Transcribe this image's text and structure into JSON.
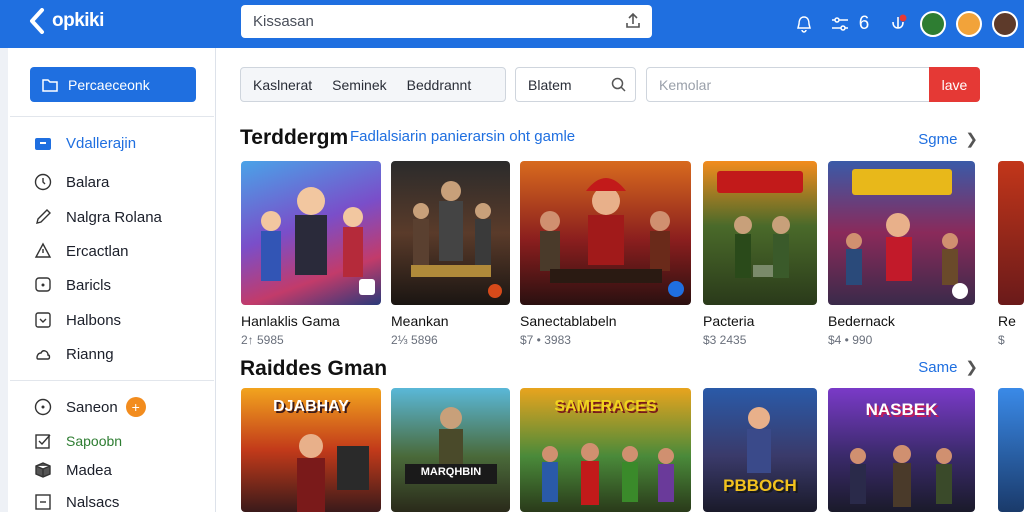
{
  "topbar": {
    "logo_text": "opkiki",
    "search_value": "Kissasan",
    "accent": "#1f6fe0"
  },
  "toolbar_icons": [
    "bell-icon",
    "sliders-icon",
    "number-badge-icon",
    "notification-icon",
    "avatar-1",
    "avatar-2",
    "avatar-3"
  ],
  "toolbar_badge": "6",
  "sidebar": {
    "primary_button": "Percaeceonk",
    "items": [
      {
        "label": "Vdallerajin",
        "icon": "folder-icon",
        "active": true
      },
      {
        "label": "Balara",
        "icon": "clock-icon"
      },
      {
        "label": "Nalgra Rolana",
        "icon": "pen-icon"
      },
      {
        "label": "Ercactlan",
        "icon": "triangle-icon"
      },
      {
        "label": "Baricls",
        "icon": "chat-icon"
      },
      {
        "label": "Halbons",
        "icon": "box-icon"
      },
      {
        "label": "Rianng",
        "icon": "cloud-icon"
      }
    ],
    "items2": [
      {
        "label": "Saneon",
        "icon": "circle-icon",
        "badge": "+"
      },
      {
        "label": "Sapoobn",
        "icon": "check-square-icon",
        "green": true
      },
      {
        "label": "Madea",
        "icon": "cube-icon"
      },
      {
        "label": "Nalsacs",
        "icon": "square-icon"
      }
    ]
  },
  "filters": {
    "tabs": [
      "Kaslnerat",
      "Seminek",
      "Beddrannt"
    ],
    "search2_value": "Blatem",
    "search3_placeholder": "Kemolar",
    "go_label": "lave",
    "go_color": "#e53935"
  },
  "section1": {
    "title": "Terddergm",
    "subtitle": "Fadlalsiarin panierarsin oht gamle",
    "see_more": "Sgme",
    "cards": [
      {
        "title": "Hanlaklis Gama",
        "meta": "2↑ 5985"
      },
      {
        "title": "Meankan",
        "meta": "2⅓ 5896"
      },
      {
        "title": "Sanectablabeln",
        "meta": "$7 • 3983"
      },
      {
        "title": "Pacteria",
        "meta": "$3 2435"
      },
      {
        "title": "Bedernack",
        "meta": "$4 • 990"
      },
      {
        "title": "Re",
        "meta": "$"
      }
    ]
  },
  "section2": {
    "title": "Raiddes Gman",
    "see_more": "Same",
    "cards": [
      {
        "title": "DJABHAY"
      },
      {
        "title": "MARQHBIN"
      },
      {
        "title": "SAMERACES"
      },
      {
        "title": "PBBOCH"
      },
      {
        "title": "NASBEK"
      },
      {
        "title": ""
      }
    ]
  }
}
